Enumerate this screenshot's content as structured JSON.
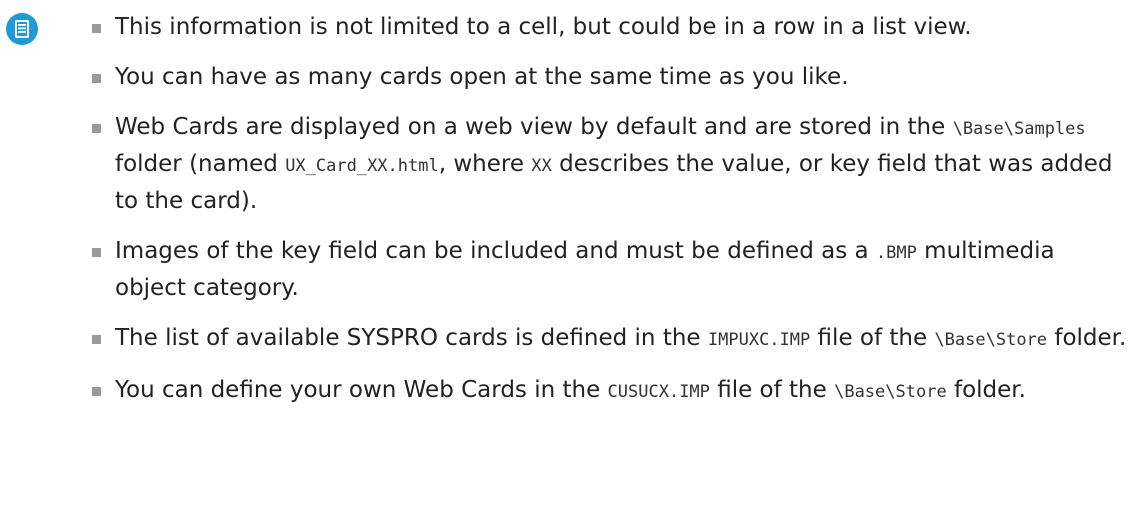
{
  "icon": "note-document-icon",
  "colors": {
    "icon": "#1f9ad6",
    "bullet": "#9a9a9a",
    "text": "#222222"
  },
  "notes": [
    {
      "parts": [
        "This information is not limited to a cell, but could be in a row in a list view."
      ]
    },
    {
      "parts": [
        "You can have as many cards open at the same time as you like."
      ]
    },
    {
      "parts": [
        "Web Cards are displayed on a web view by default and are stored in the ",
        "\\Base\\Samples",
        " folder (named ",
        "UX_Card_XX.html",
        ", where ",
        "XX",
        " describes the value, or key field that was added to the card)."
      ]
    },
    {
      "parts": [
        "Images of the key field can be included and must be defined as a ",
        ".BMP",
        " multimedia object category."
      ]
    },
    {
      "parts": [
        "The list of available SYSPRO cards is defined in the ",
        "IMPUXC.IMP",
        " file of the ",
        "\\Base\\Store",
        " folder."
      ]
    },
    {
      "parts": [
        "You can define your own Web Cards in the ",
        "CUSUCX.IMP",
        " file of the ",
        "\\Base\\Store",
        " folder."
      ]
    }
  ]
}
